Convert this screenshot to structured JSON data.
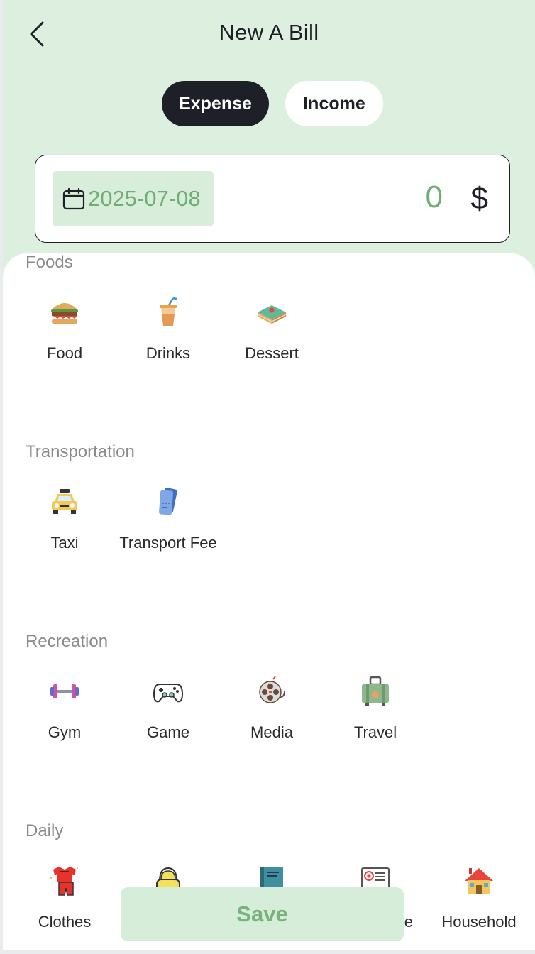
{
  "header": {
    "title": "New A Bill"
  },
  "type_toggle": {
    "expense_label": "Expense",
    "income_label": "Income",
    "selected": "Expense"
  },
  "entry": {
    "date": "2025-07-08",
    "amount": "0",
    "currency": "$"
  },
  "sections": [
    {
      "title": "Foods",
      "items": [
        {
          "label": "Food",
          "icon": "burger-icon"
        },
        {
          "label": "Drinks",
          "icon": "drink-cup-icon"
        },
        {
          "label": "Dessert",
          "icon": "cake-icon"
        }
      ]
    },
    {
      "title": "Transportation",
      "items": [
        {
          "label": "Taxi",
          "icon": "taxi-icon"
        },
        {
          "label": "Transport Fee",
          "icon": "ticket-icon"
        }
      ]
    },
    {
      "title": "Recreation",
      "items": [
        {
          "label": "Gym",
          "icon": "dumbbell-icon"
        },
        {
          "label": "Game",
          "icon": "gamepad-icon"
        },
        {
          "label": "Media",
          "icon": "film-reel-icon"
        },
        {
          "label": "Travel",
          "icon": "suitcase-icon"
        }
      ]
    },
    {
      "title": "Daily",
      "items": [
        {
          "label": "Clothes",
          "icon": "clothes-icon"
        },
        {
          "label": "",
          "icon": "bag-icon"
        },
        {
          "label": "",
          "icon": "book-icon"
        },
        {
          "label": "te",
          "icon": "certificate-icon"
        },
        {
          "label": "Household",
          "icon": "house-icon"
        }
      ]
    }
  ],
  "save_label": "Save",
  "colors": {
    "top_bg": "#ddf0e0",
    "accent_green": "#6fae74",
    "dark": "#1d2027"
  }
}
